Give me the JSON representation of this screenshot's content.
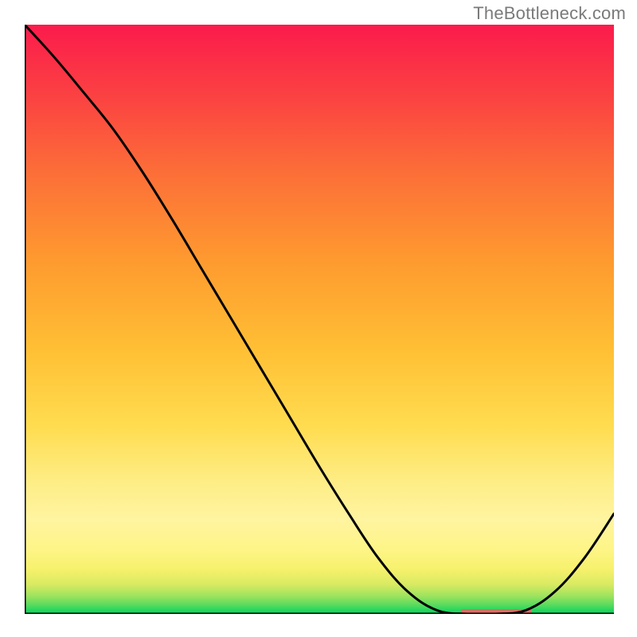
{
  "watermark": "TheBottleneck.com",
  "chart_data": {
    "type": "line",
    "title": "",
    "xlabel": "",
    "ylabel": "",
    "xlim": [
      0,
      100
    ],
    "ylim": [
      0,
      100
    ],
    "grid": false,
    "legend": false,
    "series": [
      {
        "name": "curve",
        "x": [
          0,
          5,
          10,
          15,
          20,
          25,
          30,
          35,
          40,
          45,
          50,
          55,
          60,
          65,
          70,
          75,
          80,
          85,
          90,
          95,
          100
        ],
        "y": [
          100,
          94.5,
          88.5,
          82.3,
          75.0,
          67.0,
          58.6,
          50.2,
          41.8,
          33.4,
          25.0,
          17.0,
          9.5,
          3.8,
          0.6,
          0.0,
          0.0,
          0.6,
          3.8,
          9.5,
          17.0
        ]
      }
    ],
    "flat_marker": {
      "x_start": 74,
      "x_end": 86,
      "y": 0.4,
      "color": "#dc6d63"
    },
    "gradient_stops": [
      {
        "offset": 0.0,
        "color": "#00d45f"
      },
      {
        "offset": 0.015,
        "color": "#58db5e"
      },
      {
        "offset": 0.03,
        "color": "#9ce35e"
      },
      {
        "offset": 0.05,
        "color": "#d8ea62"
      },
      {
        "offset": 0.075,
        "color": "#f6f16c"
      },
      {
        "offset": 0.11,
        "color": "#fef587"
      },
      {
        "offset": 0.16,
        "color": "#fff4a0"
      },
      {
        "offset": 0.22,
        "color": "#feee88"
      },
      {
        "offset": 0.32,
        "color": "#ffdc4f"
      },
      {
        "offset": 0.45,
        "color": "#ffbf34"
      },
      {
        "offset": 0.6,
        "color": "#fe9a2f"
      },
      {
        "offset": 0.75,
        "color": "#fc6e38"
      },
      {
        "offset": 0.88,
        "color": "#fb4142"
      },
      {
        "offset": 1.0,
        "color": "#fb1b4c"
      }
    ],
    "axis_stroke": "#000000",
    "axis_stroke_width": 3,
    "curve_stroke": "#000000",
    "curve_stroke_width": 3
  }
}
